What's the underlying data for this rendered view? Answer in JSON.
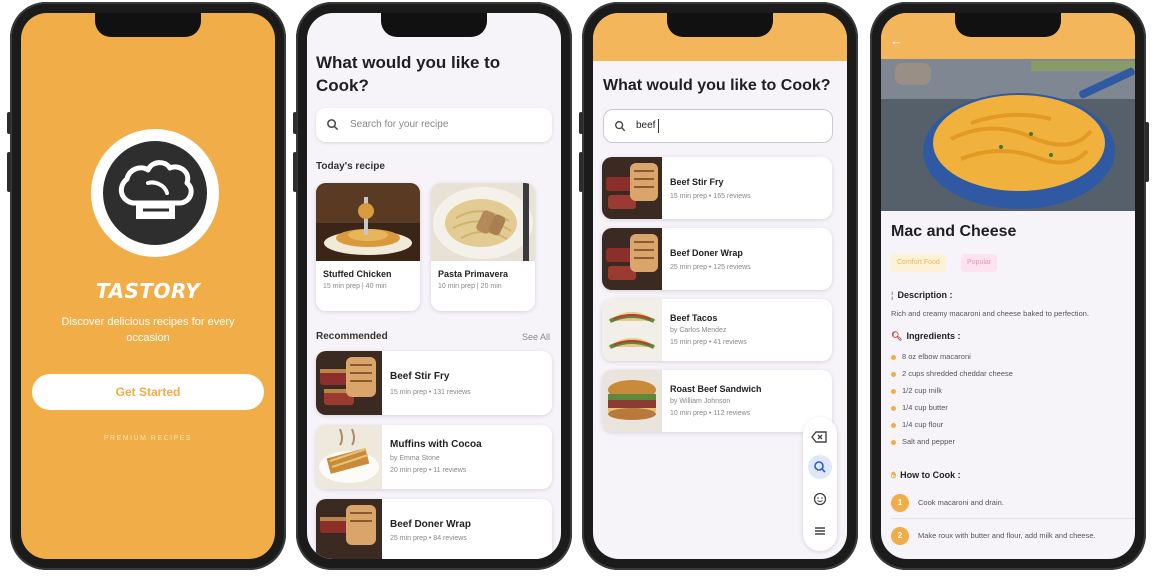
{
  "splash": {
    "brand": "TASTORY",
    "tagline": "Discover delicious recipes for every occasion",
    "get_started": "Get Started",
    "premium": "PREMIUM RECIPES"
  },
  "home": {
    "title": "What would you like to Cook?",
    "search_placeholder": "Search for your recipe",
    "todays_label": "Today's recipe",
    "todays": [
      {
        "name": "Stuffed Chicken",
        "meta": "15 min prep | 40 min"
      },
      {
        "name": "Pasta Primavera",
        "meta": "10 min prep | 20 min"
      }
    ],
    "recommended_label": "Recommended",
    "see_all": "See All",
    "recommended": [
      {
        "name": "Beef Stir Fry",
        "author": "",
        "meta": "15 min prep • 131 reviews"
      },
      {
        "name": "Muffins with Cocoa",
        "author": "by Emma Stone",
        "meta": "20 min prep • 11 reviews"
      },
      {
        "name": "Beef Doner Wrap",
        "author": "",
        "meta": "25 min prep • 84 reviews"
      }
    ]
  },
  "search": {
    "title": "What would you like to Cook?",
    "query": "beef",
    "results": [
      {
        "name": "Beef Stir Fry",
        "author": "",
        "meta": "15 min prep • 165 reviews"
      },
      {
        "name": "Beef Doner Wrap",
        "author": "",
        "meta": "25 min prep • 125 reviews"
      },
      {
        "name": "Beef Tacos",
        "author": "by Carlos Mendez",
        "meta": "15 min prep • 41 reviews"
      },
      {
        "name": "Roast Beef Sandwich",
        "author": "by William Johnson",
        "meta": "10 min prep • 112 reviews"
      }
    ]
  },
  "detail": {
    "back": "←",
    "title": "Mac and Cheese",
    "tags": [
      "Comfort Food",
      "Popular"
    ],
    "description_label": "Description :",
    "description": "Rich and creamy macaroni and cheese baked to perfection.",
    "ingredients_label": "Ingredients :",
    "ingredients": [
      "8 oz elbow macaroni",
      "2 cups shredded cheddar cheese",
      "1/2 cup milk",
      "1/4 cup butter",
      "1/4 cup flour",
      "Salt and pepper"
    ],
    "how_label": "How to Cook :",
    "steps": [
      {
        "num": "1",
        "text": "Cook macaroni and drain."
      },
      {
        "num": "2",
        "text": "Make roux with butter and flour, add milk and cheese."
      }
    ]
  },
  "colors": {
    "accent": "#f0ad48",
    "header": "#f3b65a",
    "tag_yellow": "#fdf1d6",
    "tag_pink": "#fde3ef"
  },
  "icons": [
    "chef-hat-icon",
    "search-icon",
    "backspace-icon",
    "smiley-icon",
    "menu-icon",
    "back-arrow-icon",
    "pin-icon",
    "magnifier-icon",
    "cook-hand-icon"
  ]
}
